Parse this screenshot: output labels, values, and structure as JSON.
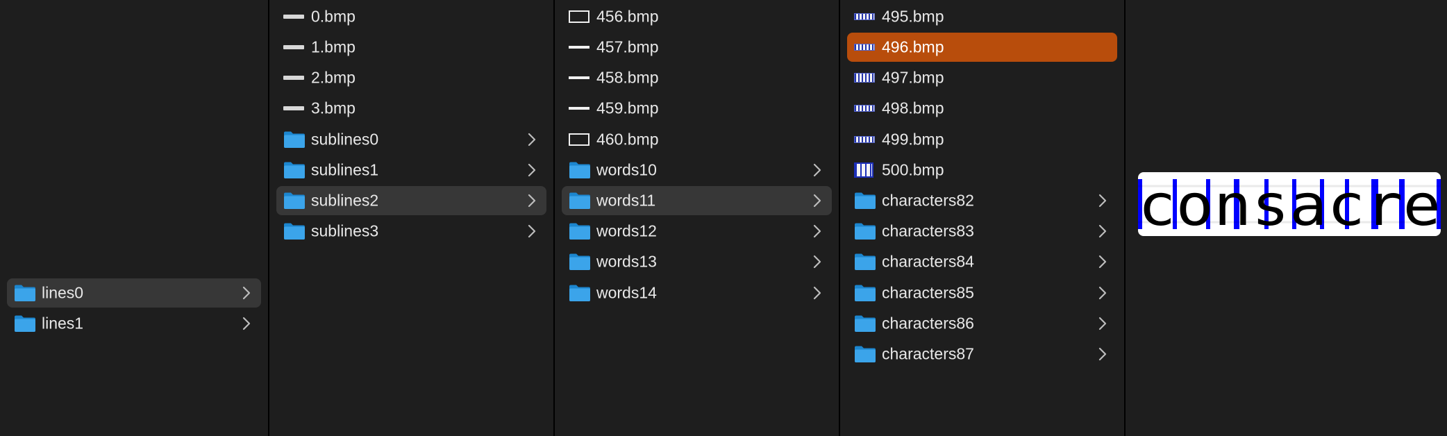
{
  "columns": [
    {
      "items": [
        {
          "label": "lines0",
          "type": "folder",
          "state": "highlighted"
        },
        {
          "label": "lines1",
          "type": "folder",
          "state": "normal"
        }
      ]
    },
    {
      "items": [
        {
          "label": "0.bmp",
          "type": "file",
          "thumb": "line"
        },
        {
          "label": "1.bmp",
          "type": "file",
          "thumb": "line"
        },
        {
          "label": "2.bmp",
          "type": "file",
          "thumb": "line"
        },
        {
          "label": "3.bmp",
          "type": "file",
          "thumb": "line"
        },
        {
          "label": "sublines0",
          "type": "folder",
          "state": "normal"
        },
        {
          "label": "sublines1",
          "type": "folder",
          "state": "normal"
        },
        {
          "label": "sublines2",
          "type": "folder",
          "state": "highlighted"
        },
        {
          "label": "sublines3",
          "type": "folder",
          "state": "normal"
        }
      ]
    },
    {
      "items": [
        {
          "label": "456.bmp",
          "type": "file",
          "thumb": "box"
        },
        {
          "label": "457.bmp",
          "type": "file",
          "thumb": "thin"
        },
        {
          "label": "458.bmp",
          "type": "file",
          "thumb": "thin"
        },
        {
          "label": "459.bmp",
          "type": "file",
          "thumb": "thin"
        },
        {
          "label": "460.bmp",
          "type": "file",
          "thumb": "box"
        },
        {
          "label": "words10",
          "type": "folder",
          "state": "normal"
        },
        {
          "label": "words11",
          "type": "folder",
          "state": "highlighted"
        },
        {
          "label": "words12",
          "type": "folder",
          "state": "normal"
        },
        {
          "label": "words13",
          "type": "folder",
          "state": "normal"
        },
        {
          "label": "words14",
          "type": "folder",
          "state": "normal"
        }
      ]
    },
    {
      "items": [
        {
          "label": "495.bmp",
          "type": "file",
          "thumb": "text"
        },
        {
          "label": "496.bmp",
          "type": "file",
          "thumb": "text",
          "state": "selected"
        },
        {
          "label": "497.bmp",
          "type": "file",
          "thumb": "text"
        },
        {
          "label": "498.bmp",
          "type": "file",
          "thumb": "text"
        },
        {
          "label": "499.bmp",
          "type": "file",
          "thumb": "text"
        },
        {
          "label": "500.bmp",
          "type": "file",
          "thumb": "text-tall"
        },
        {
          "label": "characters82",
          "type": "folder",
          "state": "normal"
        },
        {
          "label": "characters83",
          "type": "folder",
          "state": "normal"
        },
        {
          "label": "characters84",
          "type": "folder",
          "state": "normal"
        },
        {
          "label": "characters85",
          "type": "folder",
          "state": "normal"
        },
        {
          "label": "characters86",
          "type": "folder",
          "state": "normal"
        },
        {
          "label": "characters87",
          "type": "folder",
          "state": "normal"
        }
      ]
    }
  ],
  "preview": {
    "alt_text": "consacre",
    "description": "word image with blue vertical character separators"
  },
  "colors": {
    "background": "#1e1e1e",
    "highlight": "#373737",
    "selection": "#b84d0c",
    "folder_blue": "#3ba4ea",
    "separator_blue": "#0000ff"
  }
}
